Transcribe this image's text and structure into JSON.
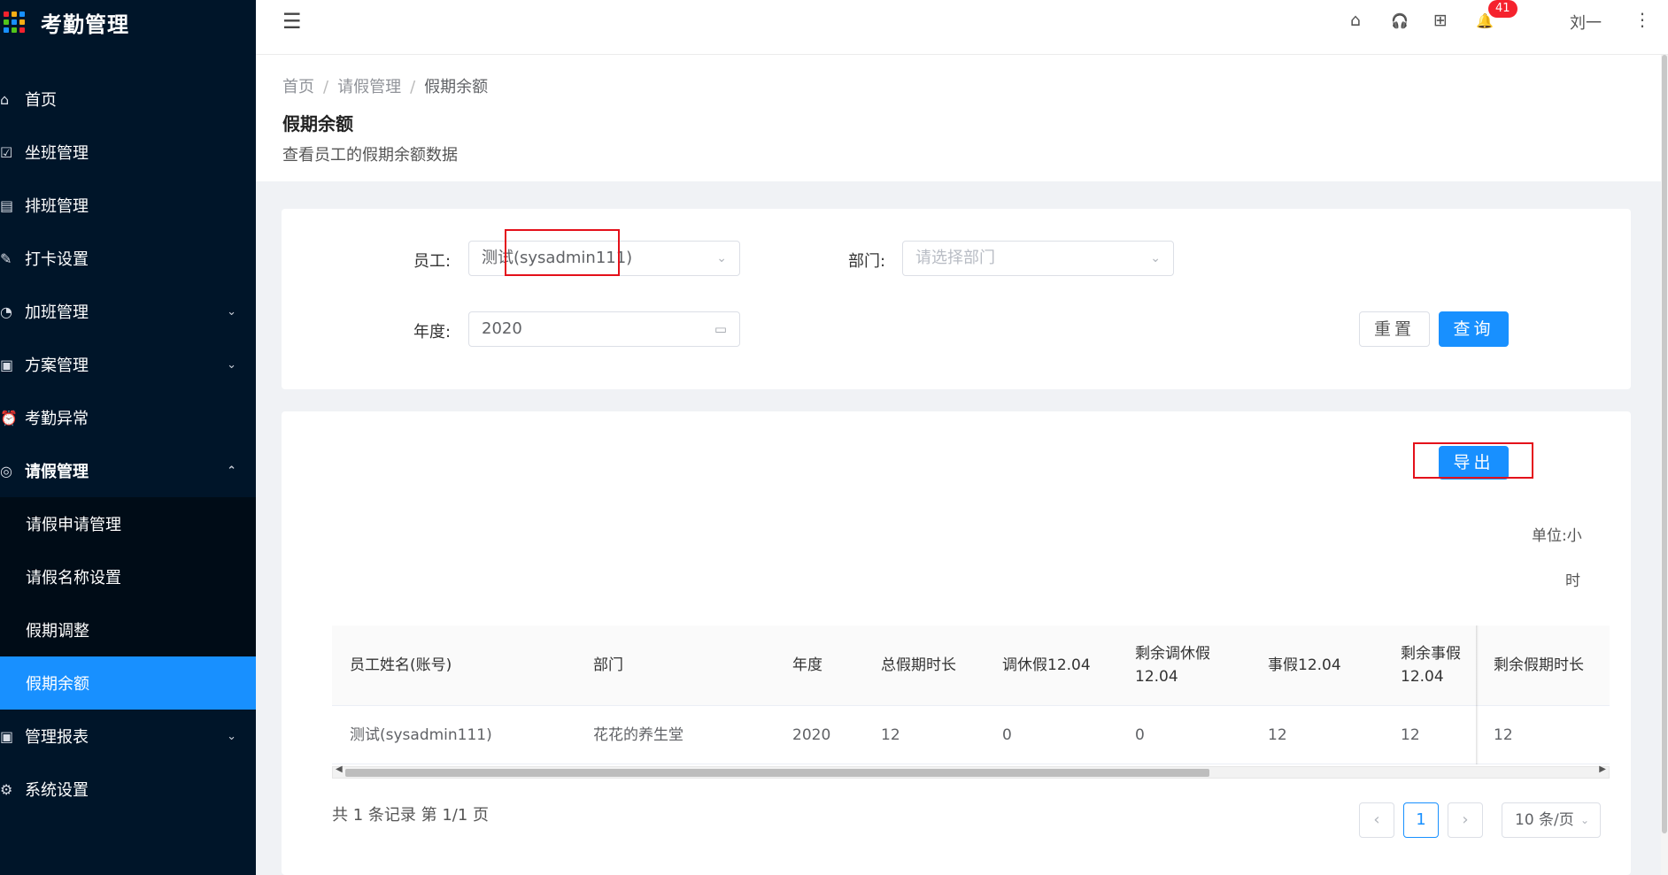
{
  "app": {
    "title": "考勤管理"
  },
  "sidebar": {
    "items": [
      {
        "label": "首页",
        "icon": "⌂"
      },
      {
        "label": "坐班管理",
        "icon": "☑"
      },
      {
        "label": "排班管理",
        "icon": "▤"
      },
      {
        "label": "打卡设置",
        "icon": "✎"
      },
      {
        "label": "加班管理",
        "icon": "◔"
      },
      {
        "label": "方案管理",
        "icon": "▣"
      },
      {
        "label": "考勤异常",
        "icon": "⏰"
      },
      {
        "label": "请假管理",
        "icon": "◎"
      },
      {
        "label": "管理报表",
        "icon": "▣"
      },
      {
        "label": "系统设置",
        "icon": "⚙"
      }
    ],
    "sub_items": [
      {
        "label": "请假申请管理"
      },
      {
        "label": "请假名称设置"
      },
      {
        "label": "假期调整"
      },
      {
        "label": "假期余额"
      }
    ],
    "chevron_down": "⌄",
    "chevron_up": "⌃"
  },
  "header": {
    "fold_icon": "☰",
    "home_icon": "⌂",
    "headset_icon": "🎧",
    "apps_icon": "⊞",
    "bell_icon": "🔔",
    "notification_count": "41",
    "user_name": "刘一",
    "more_icon": "⋮"
  },
  "breadcrumb": {
    "items": [
      "首页",
      "请假管理",
      "假期余额"
    ],
    "separator": "/"
  },
  "page": {
    "title": "假期余额",
    "description": "查看员工的假期余额数据"
  },
  "filter": {
    "employee_label": "员工:",
    "employee_value": "测试(sysadmin111)",
    "department_label": "部门:",
    "department_placeholder": "请选择部门",
    "year_label": "年度:",
    "year_value": "2020",
    "calendar_icon": "▭",
    "dropdown_icon": "⌄",
    "reset_label": "重置",
    "query_label": "查询"
  },
  "table_section": {
    "export_label": "导出",
    "unit_line1": "单位:小",
    "unit_line2": "时",
    "columns": [
      "员工姓名(账号)",
      "部门",
      "年度",
      "总假期时长",
      "调休假12.04",
      "剩余调休假12.04",
      "事假12.04",
      "剩余事假12.04",
      "剩余假期时长"
    ],
    "rows": [
      [
        "测试(sysadmin111)",
        "花花的养生堂",
        "2020",
        "12",
        "0",
        "0",
        "12",
        "12",
        "12"
      ]
    ]
  },
  "pagination": {
    "total_text": "共 1 条记录 第 1/1 页",
    "prev": "‹",
    "next": "›",
    "current_page": "1",
    "page_size": "10 条/页"
  },
  "colors": {
    "sidebar_bg": "#001529",
    "accent": "#1890ff",
    "highlight_box": "#e4101a",
    "badge": "#f5222d"
  }
}
